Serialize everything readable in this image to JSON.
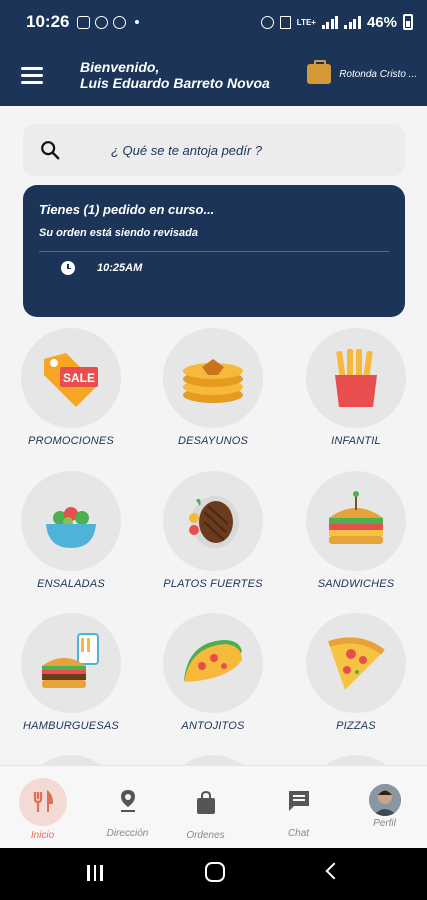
{
  "status_bar": {
    "time": "10:26",
    "battery": "46%",
    "network": "LTE+"
  },
  "header": {
    "greeting": "Bienvenido,",
    "user_name": "Luis Eduardo Barreto Novoa",
    "location": "Rotonda Cristo ..."
  },
  "search": {
    "placeholder": "¿ Qué se te antoja pedír ?"
  },
  "order_card": {
    "title": "Tienes (1) pedido en curso...",
    "status": "Su orden está siendo revisada",
    "time": "10:25AM"
  },
  "categories": [
    {
      "label": "PROMOCIONES",
      "icon": "sale-tag-icon"
    },
    {
      "label": "DESAYUNOS",
      "icon": "pancakes-icon"
    },
    {
      "label": "INFANTIL",
      "icon": "french-fries-icon"
    },
    {
      "label": "ENSALADAS",
      "icon": "salad-bowl-icon"
    },
    {
      "label": "PLATOS FUERTES",
      "icon": "steak-plate-icon"
    },
    {
      "label": "SANDWICHES",
      "icon": "sandwich-icon"
    },
    {
      "label": "HAMBURGUESAS",
      "icon": "hamburger-icon"
    },
    {
      "label": "ANTOJITOS",
      "icon": "taco-icon"
    },
    {
      "label": "PIZZAS",
      "icon": "pizza-slice-icon"
    }
  ],
  "bottom_nav": [
    {
      "label": "Inicio",
      "icon": "fork-knife-icon",
      "active": true
    },
    {
      "label": "Dirección",
      "icon": "location-pin-icon",
      "active": false
    },
    {
      "label": "Ordenes",
      "icon": "shopping-bag-icon",
      "active": false
    },
    {
      "label": "Chat",
      "icon": "chat-icon",
      "active": false
    },
    {
      "label": "Perfil",
      "icon": "avatar-icon",
      "active": false
    }
  ],
  "colors": {
    "primary": "#1b3457",
    "accent": "#e0704f",
    "background": "#f4f4f4"
  }
}
